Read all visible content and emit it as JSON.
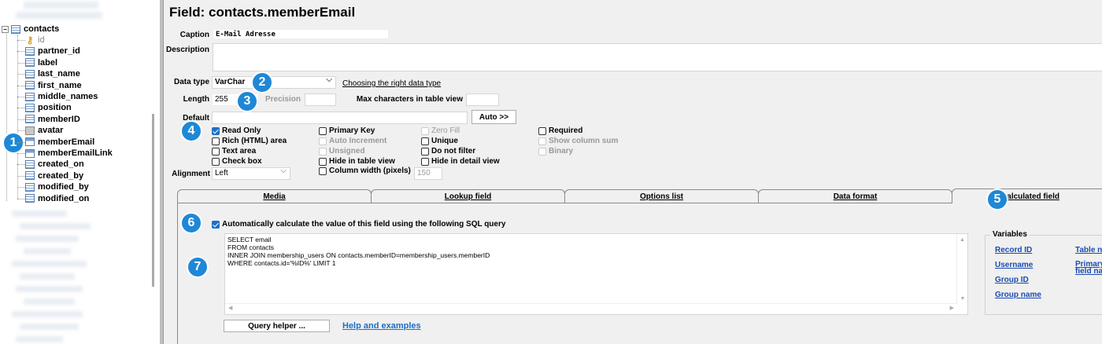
{
  "tree": {
    "table": "contacts",
    "fields": [
      {
        "label": "id",
        "kind": "key"
      },
      {
        "label": "partner_id",
        "kind": "field"
      },
      {
        "label": "label",
        "kind": "field"
      },
      {
        "label": "last_name",
        "kind": "field"
      },
      {
        "label": "first_name",
        "kind": "field"
      },
      {
        "label": "middle_names",
        "kind": "field"
      },
      {
        "label": "position",
        "kind": "field"
      },
      {
        "label": "memberID",
        "kind": "field"
      },
      {
        "label": "avatar",
        "kind": "image"
      },
      {
        "label": "memberEmail",
        "kind": "sql"
      },
      {
        "label": "memberEmailLink",
        "kind": "sql"
      },
      {
        "label": "created_on",
        "kind": "field"
      },
      {
        "label": "created_by",
        "kind": "field"
      },
      {
        "label": "modified_by",
        "kind": "field"
      },
      {
        "label": "modified_on",
        "kind": "field"
      }
    ]
  },
  "header": {
    "title": "Field: contacts.memberEmail"
  },
  "form": {
    "caption_label": "Caption",
    "caption_value": "E-Mail Adresse",
    "description_label": "Description",
    "description_value": "",
    "datatype_label": "Data type",
    "datatype_value": "VarChar",
    "datatype_link": "Choosing the right data type",
    "length_label": "Length",
    "length_value": "255",
    "precision_label": "Precision",
    "maxchars_label": "Max characters in table view",
    "default_label": "Default",
    "auto_button": "Auto >>",
    "alignment_label": "Alignment",
    "alignment_value": "Left",
    "colwidth_value": "150"
  },
  "options": {
    "read_only": "Read Only",
    "rich_html": "Rich (HTML) area",
    "text_area": "Text area",
    "check_box": "Check box",
    "primary_key": "Primary Key",
    "auto_increment": "Auto Increment",
    "unsigned": "Unsigned",
    "hide_table": "Hide in table view",
    "col_width": "Column width (pixels)",
    "zero_fill": "Zero Fill",
    "unique": "Unique",
    "no_filter": "Do not filter",
    "hide_detail": "Hide in detail view",
    "required": "Required",
    "col_sum": "Show column sum",
    "binary": "Binary"
  },
  "tabs": [
    "Media",
    "Lookup field",
    "Options list",
    "Data format",
    "Calculated field"
  ],
  "calc": {
    "auto_label": "Automatically calculate the value of this field using the following SQL query",
    "sql_lines": [
      "SELECT email",
      "FROM contacts",
      "INNER JOIN membership_users ON contacts.memberID=membership_users.memberID",
      "WHERE contacts.id='%ID%' LIMIT 1"
    ],
    "query_helper": "Query helper ...",
    "help_link": "Help and examples"
  },
  "variables": {
    "title": "Variables",
    "record_id": "Record ID",
    "username": "Username",
    "group_id": "Group ID",
    "group_name": "Group name",
    "table_name": "Table na",
    "primary_line1": "Primary",
    "primary_line2": "field nar"
  },
  "badges": [
    "1",
    "2",
    "3",
    "4",
    "5",
    "6",
    "7"
  ],
  "colors": {
    "accent": "#1e88d6",
    "link": "#1a4bb0",
    "checkbox": "#1f6fc5"
  }
}
